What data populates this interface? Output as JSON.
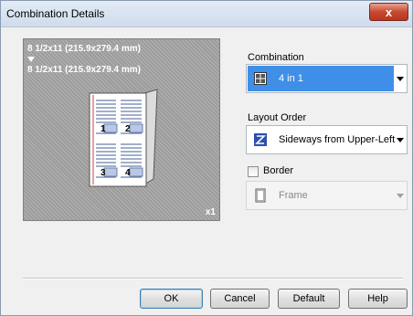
{
  "window": {
    "title": "Combination Details",
    "close_glyph": "x"
  },
  "preview": {
    "paper_size_top": "8 1/2x11 (215.9x279.4 mm)",
    "paper_size_bottom": "8 1/2x11 (215.9x279.4 mm)",
    "copies": "x1",
    "page_numbers": [
      "1",
      "2",
      "3",
      "4"
    ]
  },
  "combination": {
    "label": "Combination",
    "value": "4 in 1",
    "icon": "grid-2x2-icon"
  },
  "layout_order": {
    "label": "Layout Order",
    "value": "Sideways from Upper-Left",
    "icon": "z-order-icon"
  },
  "border": {
    "label": "Border",
    "checked": false,
    "value": "Frame",
    "icon": "frame-icon"
  },
  "buttons": {
    "ok": "OK",
    "cancel": "Cancel",
    "default": "Default",
    "help": "Help"
  },
  "colors": {
    "selection": "#3f8fe8",
    "preview_bg": "#9c9c9c",
    "close_button": "#c74a2f"
  }
}
